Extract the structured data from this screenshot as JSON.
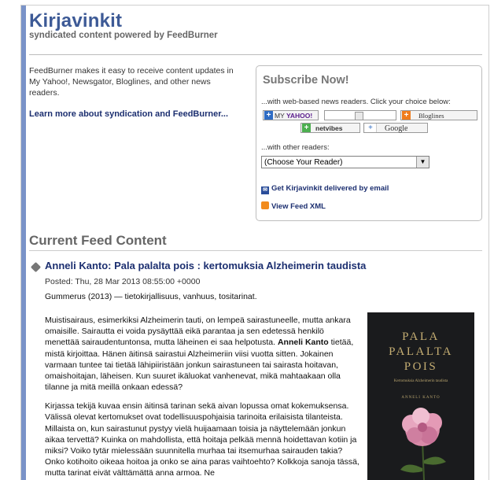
{
  "header": {
    "title": "Kirjavinkit",
    "subtitle": "syndicated content powered by FeedBurner"
  },
  "intro": {
    "text": "FeedBurner makes it easy to receive content updates in My Yahoo!, Newsgator, Bloglines, and other news readers.",
    "learn_more": "Learn more about syndication and FeedBurner..."
  },
  "subscribe": {
    "title": "Subscribe Now!",
    "web_readers_label": "...with web-based news readers. Click your choice below:",
    "buttons": {
      "myyahoo_prefix": "MY",
      "myyahoo_brand": "YAHOO!",
      "bloglines": "Bloglines",
      "netvibes": "netvibes",
      "google": "Google"
    },
    "other_readers_label": "...with other readers:",
    "reader_select_value": "(Choose Your Reader)",
    "email_link": "Get Kirjavinkit delivered by email",
    "xml_link": "View Feed XML"
  },
  "feed": {
    "heading": "Current Feed Content",
    "item": {
      "title": "Anneli Kanto: Pala palalta pois : kertomuksia Alzheimerin taudista",
      "posted": "Posted: Thu, 28 Mar 2013 08:55:00 +0000",
      "summary": "Gummerus (2013) — tietokirjallisuus, vanhuus, tositarinat.",
      "p1_before": "Muistisairaus, esimerkiksi Alzheimerin tauti, on lempeä sairastuneelle, mutta ankara omaisille. Sairautta ei voida pysäyttää eikä parantaa ja sen edetessä henkilö menettää sairaudentuntonsa, mutta läheinen ei saa helpotusta. ",
      "p1_bold": "Anneli Kanto",
      "p1_after": " tietää, mistä kirjoittaa. Hänen äitinsä sairastui Alzheimeriin viisi vuotta sitten. Jokainen varmaan tuntee tai tietää lähipiiristään jonkun sairastuneen tai sairasta hoitavan, omaishoitajan, läheisen. Kun suuret ikäluokat vanhenevat, mikä mahtaakaan olla tilanne ja mitä meillä onkaan edessä?",
      "p2": "Kirjassa tekijä kuvaa ensin äitinsä tarinan sekä aivan lopussa omat kokemuksensa. Välissä olevat kertomukset ovat todellisuuspohjaisia tarinoita erilaisista tilanteista. Millaista on, kun sairastunut pystyy vielä huijaamaan toisia ja näyttelemään jonkun aikaa tervettä? Kuinka on mahdollista, että hoitaja pelkää mennä hoidettavan kotiin ja miksi? Voiko tytär mielessään suunnitella murhaa tai itsemurhaa sairauden takia? Onko kotihoito oikeaa hoitoa ja onko se aina paras vaihtoehto? Kolkkoja sanoja tässä, mutta tarinat eivät välttämättä anna armoa. Ne",
      "cover": {
        "line1": "PALA",
        "line2": "PALALTA",
        "line3": "POIS",
        "subtitle": "Kertomuksia Alzheimerin taudista",
        "author": "ANNELI KANTO"
      }
    }
  },
  "colors": {
    "title_blue": "#3d5a96",
    "link_navy": "#1c2f70",
    "left_bar": "#7a93c8",
    "cover_bg": "#1a1b1d",
    "cover_gold": "#c4ad72"
  }
}
